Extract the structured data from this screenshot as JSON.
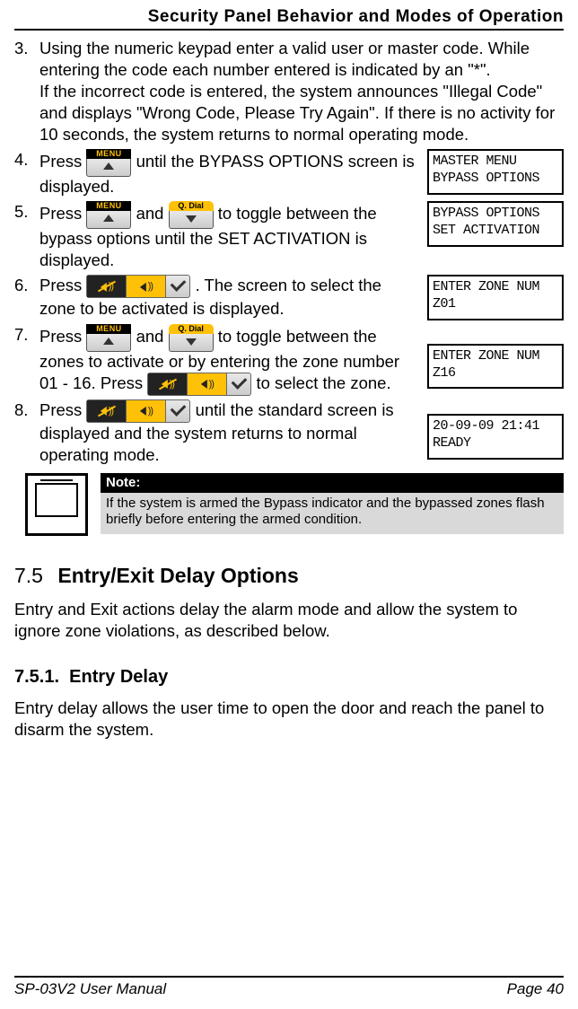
{
  "header": {
    "title": "Security Panel Behavior and Modes of Operation"
  },
  "steps": [
    {
      "num": "3.",
      "text": "Using the numeric keypad enter a valid user or master code. While entering the code each number entered is indicated by an \"*\".\nIf the incorrect code is entered, the system announces \"Illegal Code\" and displays \"Wrong Code, Please Try Again\". If there is no activity for 10 seconds, the system returns to normal operating mode."
    },
    {
      "num": "4.",
      "pre": "Press ",
      "post": " until the BYPASS OPTIONS screen is displayed.",
      "screen": {
        "line1": "MASTER MENU",
        "line2": "BYPASS OPTIONS"
      }
    },
    {
      "num": "5.",
      "pre": "Press ",
      "mid": " and ",
      "post": " to toggle between the bypass options until the SET ACTIVATION is displayed.",
      "screen": {
        "line1": "BYPASS OPTIONS",
        "line2": "SET ACTIVATION"
      }
    },
    {
      "num": "6.",
      "pre": "Press ",
      "post": ". The screen to select the zone to be activated is displayed.",
      "screen": {
        "line1": "ENTER ZONE NUM",
        "line2": "Z01"
      }
    },
    {
      "num": "7.",
      "pre": "Press ",
      "mid": " and ",
      "post1": " to toggle between the zones to activate or by entering the zone number 01 - 16. Press ",
      "post2": " to select the zone.",
      "screen": {
        "line1": "ENTER ZONE NUM",
        "line2": "Z16"
      }
    },
    {
      "num": "8.",
      "pre": "Press ",
      "post": " until the standard screen is displayed and the system returns to normal operating mode.",
      "screen": {
        "line1": "20-09-09  21:41",
        "line2": "READY"
      }
    }
  ],
  "buttons": {
    "menu_label": "MENU",
    "qdial_label": "Q. Dial"
  },
  "note": {
    "label": "Note:",
    "text": "If the system is armed the Bypass indicator and the bypassed zones flash briefly before entering the armed condition."
  },
  "section": {
    "num": "7.5",
    "title": "Entry/Exit Delay Options",
    "para": "Entry and Exit actions delay the alarm mode and allow the system to ignore zone violations, as described below."
  },
  "subsection": {
    "num": "7.5.1.",
    "title": "Entry Delay",
    "para": "Entry delay allows the user time to open the door and reach the panel to disarm the system."
  },
  "footer": {
    "left": "SP-03V2 User Manual",
    "right": "Page 40"
  }
}
